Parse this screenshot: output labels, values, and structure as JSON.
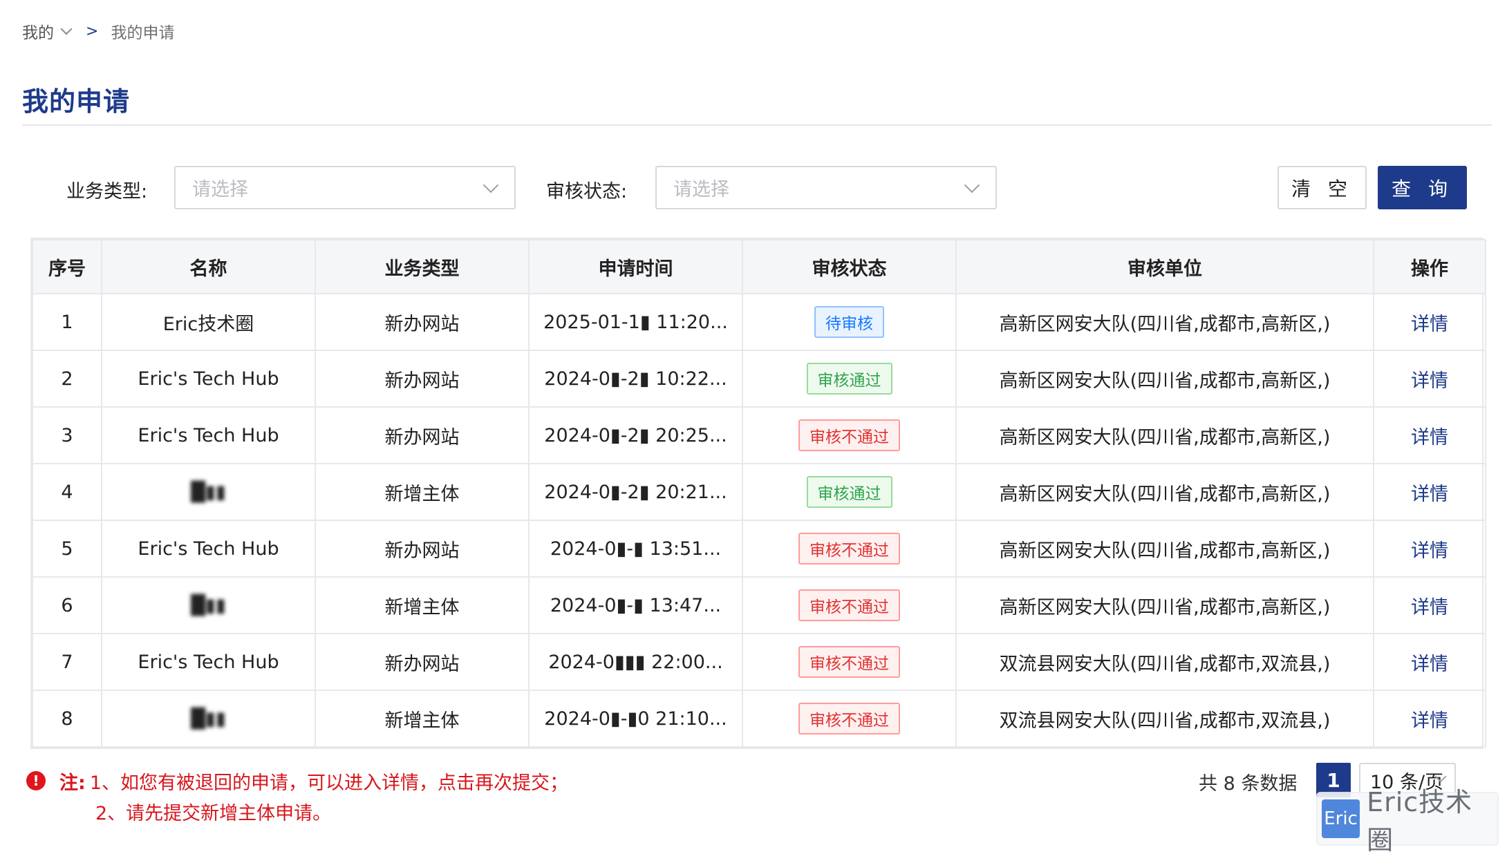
{
  "breadcrumb": {
    "parent": "我的",
    "separator": ">",
    "current": "我的申请"
  },
  "page": {
    "title": "我的申请"
  },
  "filters": {
    "business_type": {
      "label": "业务类型:",
      "placeholder": "请选择"
    },
    "review_status": {
      "label": "审核状态:",
      "placeholder": "请选择"
    },
    "clear_label": "清 空",
    "query_label": "查 询"
  },
  "table": {
    "headers": [
      "序号",
      "名称",
      "业务类型",
      "申请时间",
      "审核状态",
      "审核单位",
      "操作"
    ],
    "rows": [
      {
        "no": "1",
        "name": "Eric技术圈",
        "type": "新办网站",
        "time": "2025-01-1▮ 11:20...",
        "status": "待审核",
        "status_kind": "pending",
        "unit": "高新区网安大队(四川省,成都市,高新区,)",
        "action": "详情"
      },
      {
        "no": "2",
        "name": "Eric's Tech Hub",
        "type": "新办网站",
        "time": "2024-0▮-2▮ 10:22...",
        "status": "审核通过",
        "status_kind": "pass",
        "unit": "高新区网安大队(四川省,成都市,高新区,)",
        "action": "详情"
      },
      {
        "no": "3",
        "name": "Eric's Tech Hub",
        "type": "新办网站",
        "time": "2024-0▮-2▮ 20:25...",
        "status": "审核不通过",
        "status_kind": "fail",
        "unit": "高新区网安大队(四川省,成都市,高新区,)",
        "action": "详情"
      },
      {
        "no": "4",
        "name": "█▮▮",
        "type": "新增主体",
        "time": "2024-0▮-2▮ 20:21...",
        "status": "审核通过",
        "status_kind": "pass",
        "unit": "高新区网安大队(四川省,成都市,高新区,)",
        "action": "详情"
      },
      {
        "no": "5",
        "name": "Eric's Tech Hub",
        "type": "新办网站",
        "time": "2024-0▮-▮ 13:51...",
        "status": "审核不通过",
        "status_kind": "fail",
        "unit": "高新区网安大队(四川省,成都市,高新区,)",
        "action": "详情"
      },
      {
        "no": "6",
        "name": "█▮▮",
        "type": "新增主体",
        "time": "2024-0▮-▮ 13:47...",
        "status": "审核不通过",
        "status_kind": "fail",
        "unit": "高新区网安大队(四川省,成都市,高新区,)",
        "action": "详情"
      },
      {
        "no": "7",
        "name": "Eric's Tech Hub",
        "type": "新办网站",
        "time": "2024-0▮▮▮ 22:00...",
        "status": "审核不通过",
        "status_kind": "fail",
        "unit": "双流县网安大队(四川省,成都市,双流县,)",
        "action": "详情"
      },
      {
        "no": "8",
        "name": "█▮▮",
        "type": "新增主体",
        "time": "2024-0▮-▮0 21:10...",
        "status": "审核不通过",
        "status_kind": "fail",
        "unit": "双流县网安大队(四川省,成都市,双流县,)",
        "action": "详情"
      }
    ]
  },
  "notes": {
    "icon": "!",
    "prefix": "注:",
    "line1": "1、如您有被退回的申请，可以进入详情，点击再次提交；",
    "line2": "2、请先提交新增主体申请。"
  },
  "pagination": {
    "total_text": "共 8 条数据",
    "current_page": "1",
    "page_size": "10 条/页"
  },
  "watermark": {
    "logo_text": "Eric",
    "text": "Eric技术圈"
  },
  "colors": {
    "primary": "#1e3a8a",
    "pending": "#1677ff",
    "pass": "#2da44e",
    "fail": "#e03131"
  }
}
